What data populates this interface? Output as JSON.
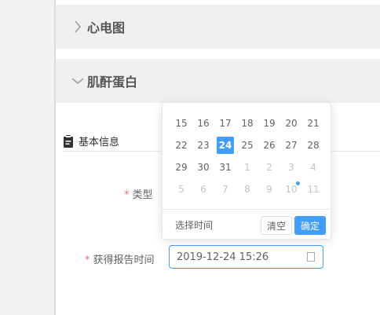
{
  "panels": [
    {
      "title": "心电图",
      "expanded": false
    },
    {
      "title": "肌酐蛋白",
      "expanded": true
    }
  ],
  "section": {
    "title": "基本信息",
    "icon": "clipboard-icon"
  },
  "form": {
    "type_label": "类型",
    "report_time_label": "获得报告时间",
    "report_time_value": "2019-12-24 15:26",
    "required_mark": "*"
  },
  "calendar": {
    "rows": [
      [
        {
          "d": "15"
        },
        {
          "d": "16"
        },
        {
          "d": "17"
        },
        {
          "d": "18"
        },
        {
          "d": "19"
        },
        {
          "d": "20"
        },
        {
          "d": "21"
        }
      ],
      [
        {
          "d": "22"
        },
        {
          "d": "23"
        },
        {
          "d": "24",
          "selected": true
        },
        {
          "d": "25"
        },
        {
          "d": "26"
        },
        {
          "d": "27"
        },
        {
          "d": "28"
        }
      ],
      [
        {
          "d": "29"
        },
        {
          "d": "30"
        },
        {
          "d": "31"
        },
        {
          "d": "1",
          "other": true
        },
        {
          "d": "2",
          "other": true
        },
        {
          "d": "3",
          "other": true
        },
        {
          "d": "4",
          "other": true
        }
      ],
      [
        {
          "d": "5",
          "other": true
        },
        {
          "d": "6",
          "other": true
        },
        {
          "d": "7",
          "other": true
        },
        {
          "d": "8",
          "other": true
        },
        {
          "d": "9",
          "other": true
        },
        {
          "d": "10",
          "other": true,
          "today": true
        },
        {
          "d": "11",
          "other": true
        }
      ]
    ],
    "select_time_label": "选择时间",
    "clear_label": "清空",
    "confirm_label": "确定"
  },
  "colors": {
    "accent": "#409eff",
    "required": "#f56c6c"
  }
}
